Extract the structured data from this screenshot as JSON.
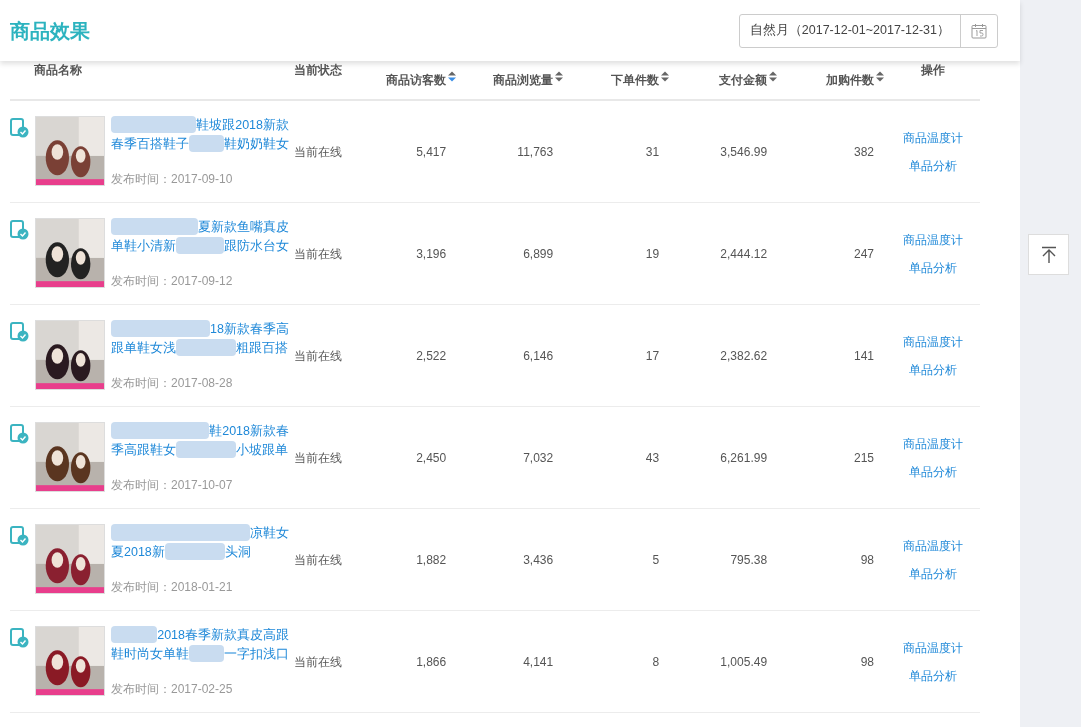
{
  "page_title": "商品效果",
  "date_range": {
    "label": "自然月（2017-12-01~2017-12-31）"
  },
  "table": {
    "columns": [
      {
        "kind": "name",
        "label": "商品名称",
        "sortable": false
      },
      {
        "kind": "status",
        "label": "当前状态",
        "sortable": false
      },
      {
        "kind": "number",
        "label": "商品访客数",
        "sortable": true,
        "sorted": true
      },
      {
        "kind": "number",
        "label": "商品浏览量",
        "sortable": true,
        "sorted": false
      },
      {
        "kind": "number",
        "label": "下单件数",
        "sortable": true,
        "sorted": false
      },
      {
        "kind": "number",
        "label": "支付金额",
        "sortable": true,
        "sorted": false
      },
      {
        "kind": "number",
        "label": "加购件数",
        "sortable": true,
        "sorted": false
      },
      {
        "kind": "actions",
        "label": "操作",
        "sortable": false
      }
    ],
    "rows": [
      {
        "title_lines": [
          [
            {
              "kind": "blur"
            },
            {
              "kind": "text",
              "text": "鞋坡跟2018新款"
            }
          ],
          [
            {
              "kind": "text",
              "text": "春季百搭鞋子"
            },
            {
              "kind": "blur"
            },
            {
              "kind": "text",
              "text": "鞋奶奶鞋女"
            }
          ]
        ],
        "published": "发布时间：2017-09-10",
        "status": "当前在线",
        "metrics": [
          "5,417",
          "11,763",
          "31",
          "3,546.99",
          "382"
        ],
        "actions": [
          "商品温度计",
          "单品分析"
        ]
      },
      {
        "title_lines": [
          [
            {
              "kind": "blur"
            },
            {
              "kind": "text",
              "text": "夏新款鱼嘴真皮"
            }
          ],
          [
            {
              "kind": "text",
              "text": "单鞋小清新"
            },
            {
              "kind": "blur"
            },
            {
              "kind": "text",
              "text": "跟防水台女"
            }
          ]
        ],
        "published": "发布时间：2017-09-12",
        "status": "当前在线",
        "metrics": [
          "3,196",
          "6,899",
          "19",
          "2,444.12",
          "247"
        ],
        "actions": [
          "商品温度计",
          "单品分析"
        ]
      },
      {
        "title_lines": [
          [
            {
              "kind": "blur"
            },
            {
              "kind": "text",
              "text": "18新款春季高"
            }
          ],
          [
            {
              "kind": "text",
              "text": "跟单鞋女浅"
            },
            {
              "kind": "blur"
            },
            {
              "kind": "text",
              "text": "粗跟百搭"
            }
          ]
        ],
        "published": "发布时间：2017-08-28",
        "status": "当前在线",
        "metrics": [
          "2,522",
          "6,146",
          "17",
          "2,382.62",
          "141"
        ],
        "actions": [
          "商品温度计",
          "单品分析"
        ]
      },
      {
        "title_lines": [
          [
            {
              "kind": "blur"
            },
            {
              "kind": "text",
              "text": "鞋2018新款春"
            }
          ],
          [
            {
              "kind": "text",
              "text": "季高跟鞋女"
            },
            {
              "kind": "blur"
            },
            {
              "kind": "text",
              "text": "小坡跟单"
            }
          ]
        ],
        "published": "发布时间：2017-10-07",
        "status": "当前在线",
        "metrics": [
          "2,450",
          "7,032",
          "43",
          "6,261.99",
          "215"
        ],
        "actions": [
          "商品温度计",
          "单品分析"
        ]
      },
      {
        "title_lines": [
          [
            {
              "kind": "blur"
            },
            {
              "kind": "text",
              "text": "凉鞋女"
            }
          ],
          [
            {
              "kind": "text",
              "text": "夏2018新"
            },
            {
              "kind": "blur"
            },
            {
              "kind": "text",
              "text": "头洞"
            }
          ]
        ],
        "published": "发布时间：2018-01-21",
        "status": "当前在线",
        "metrics": [
          "1,882",
          "3,436",
          "5",
          "795.38",
          "98"
        ],
        "actions": [
          "商品温度计",
          "单品分析"
        ]
      },
      {
        "title_lines": [
          [
            {
              "kind": "blur"
            },
            {
              "kind": "text",
              "text": "2018春季新款真皮高跟"
            }
          ],
          [
            {
              "kind": "text",
              "text": "鞋时尚女单鞋"
            },
            {
              "kind": "blur"
            },
            {
              "kind": "text",
              "text": "一字扣浅口"
            }
          ]
        ],
        "published": "发布时间：2017-02-25",
        "status": "当前在线",
        "metrics": [
          "1,866",
          "4,141",
          "8",
          "1,005.49",
          "98"
        ],
        "actions": [
          "商品温度计",
          "单品分析"
        ]
      }
    ]
  }
}
